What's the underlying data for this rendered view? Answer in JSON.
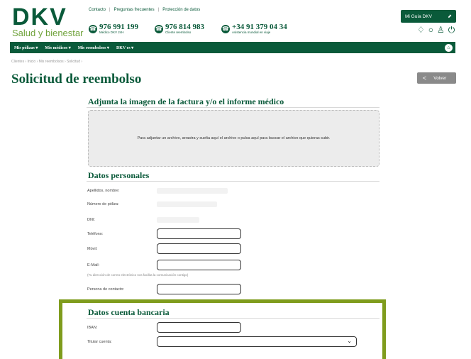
{
  "brand": {
    "logo_text": "DKV",
    "tagline": "Salud y bienestar"
  },
  "top_links": [
    "Contacto",
    "Preguntas frecuentes",
    "Protección de datos"
  ],
  "phones": [
    {
      "number": "976 991 199",
      "caption": "Médico DKV 24H"
    },
    {
      "number": "976 814 983",
      "caption": "Cliente reembolso"
    },
    {
      "number": "+34 91 379 04 34",
      "caption": "Asistencia mundial en viaje"
    }
  ],
  "mi_guia": {
    "label": "Mi Guía DKV",
    "arrow": "⬈"
  },
  "header_icons": [
    "bell-icon",
    "chat-icon",
    "user-icon",
    "power-icon"
  ],
  "nav": [
    {
      "label": "Mis pólizas ▾"
    },
    {
      "label": "Mis médicos ▾"
    },
    {
      "label": "Mis reembolsos ▾"
    },
    {
      "label": "DKV es ▾"
    }
  ],
  "breadcrumb": "Clientes  ›  Inicio  ›  Mis reembolsos  ›  Solicitud  ›",
  "page_title": "Solicitud de reembolso",
  "back_button": {
    "label": "Volver",
    "chevron": "<"
  },
  "attach_section": {
    "title": "Adjunta la imagen de la factura y/o el informe médico",
    "dropzone_text": "Para adjuntar un archivo, arrastra y suelta aquí el archivo o pulsa aquí para buscar el archivo que quieras subir."
  },
  "personal_section": {
    "title": "Datos personales",
    "fields": {
      "nombre": "Apellidos, nombre:",
      "poliza": "Número de póliza:",
      "dni": "DNI:",
      "telefono": "Teléfono:",
      "movil": "Móvil:",
      "email": "E-Mail:",
      "contacto": "Persona de contacto:"
    },
    "email_note": "(Tu dirección de correo electrónico nos facilita la comunicación contigo)"
  },
  "bank_section": {
    "title": "Datos cuenta bancaria",
    "fields": {
      "iban": "IBAN:",
      "titular": "Titular cuenta:"
    }
  }
}
